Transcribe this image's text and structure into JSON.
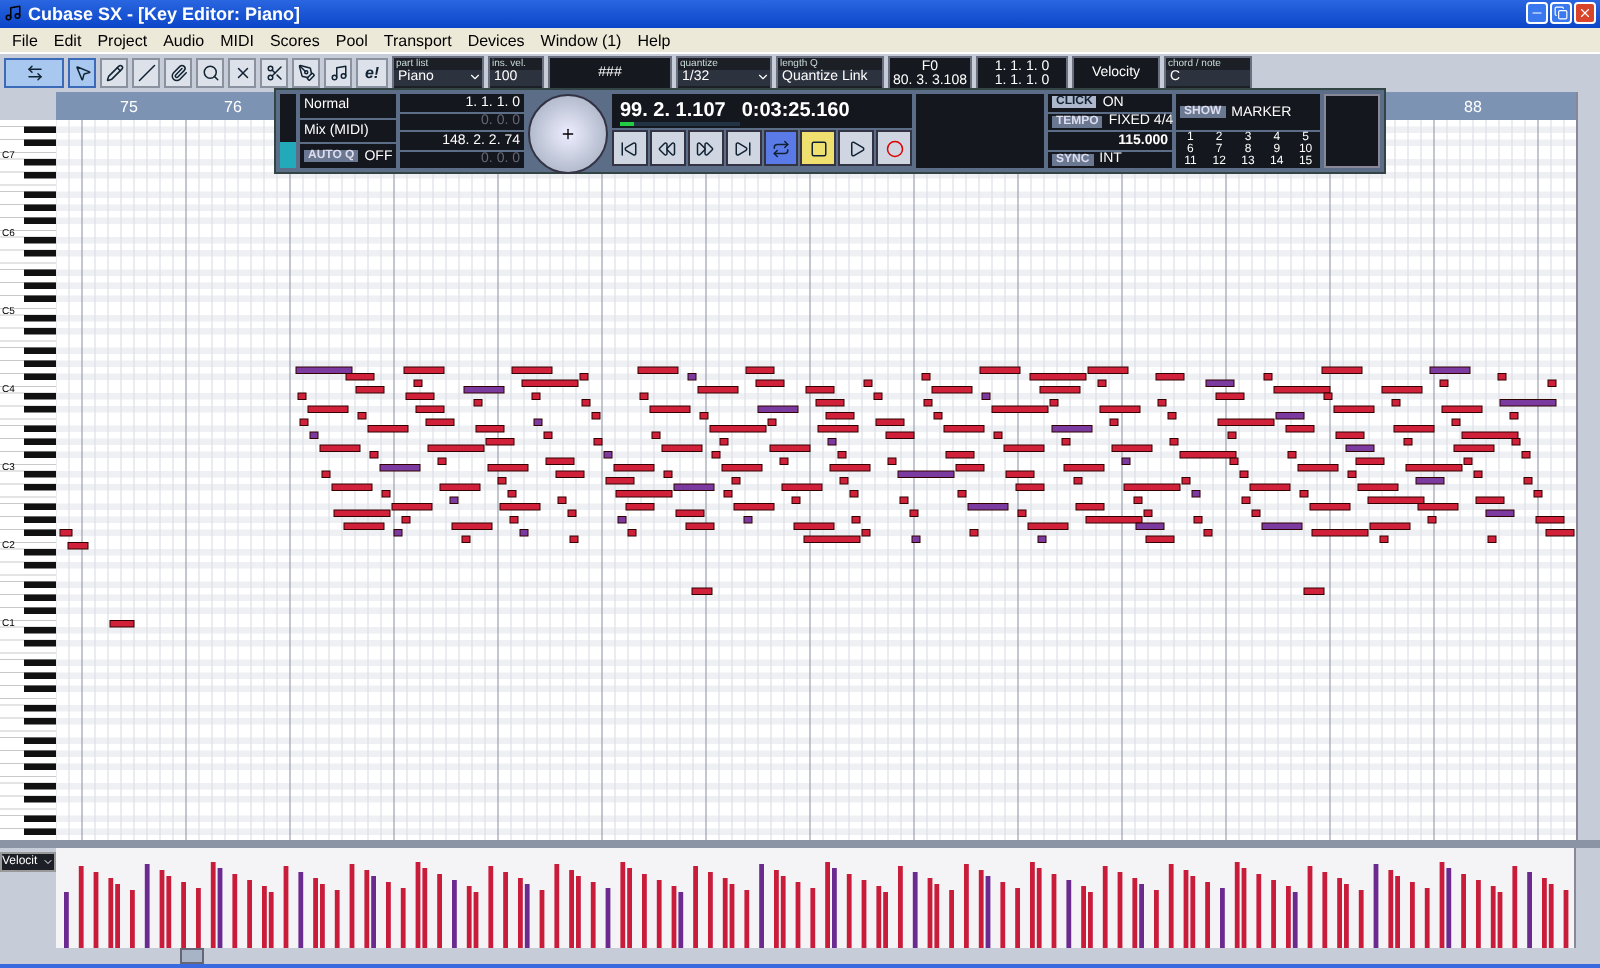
{
  "window": {
    "title": "Cubase SX - [Key Editor: Piano]"
  },
  "menu": [
    "File",
    "Edit",
    "Project",
    "Audio",
    "MIDI",
    "Scores",
    "Pool",
    "Transport",
    "Devices",
    "Window (1)",
    "Help"
  ],
  "toolbar": {
    "tools": [
      {
        "kind": "arrow",
        "selected": true
      },
      {
        "kind": "pencil",
        "selected": false
      },
      {
        "kind": "line",
        "selected": false
      },
      {
        "kind": "glue",
        "selected": false
      },
      {
        "kind": "zoom",
        "selected": false
      },
      {
        "kind": "mute",
        "selected": false
      },
      {
        "kind": "split",
        "selected": false
      },
      {
        "kind": "pen",
        "selected": false
      },
      {
        "kind": "drum",
        "selected": false
      }
    ],
    "autoscroll": {
      "on": true
    },
    "edit_in_place": "e!",
    "part_list": {
      "label": "part list",
      "value": "Piano"
    },
    "ins_vel": {
      "label": "ins. vel.",
      "value": "100"
    },
    "grid_value": "###",
    "quantize": {
      "label": "quantize",
      "value": "1/32"
    },
    "length_q": {
      "label": "length Q",
      "value": "Quantize Link"
    },
    "mouse_note": "F0",
    "mouse_position": "80. 3. 3.108",
    "note_start": "1. 1. 1. 0",
    "note_end": "1. 1. 1. 0",
    "colors": {
      "value": "Velocity"
    },
    "chord": {
      "label": "chord / note",
      "value": "C"
    }
  },
  "ruler": [
    "75",
    "76",
    "88"
  ],
  "transport": {
    "modes": [
      "Normal",
      "Mix (MIDI)"
    ],
    "autoq": {
      "label": "AUTO Q",
      "value": "OFF"
    },
    "left_locator": "1. 1. 1. 0",
    "left_offset": "0. 0. 0",
    "right_locator": "148. 2. 2. 74",
    "right_offset": "0. 0. 0",
    "primary_position": "99. 2. 1.107",
    "secondary_position": "0:03:25.160",
    "level": 0.12,
    "buttons": [
      {
        "kind": "start",
        "active": false
      },
      {
        "kind": "rewind",
        "active": false
      },
      {
        "kind": "forward",
        "active": false
      },
      {
        "kind": "end",
        "active": false
      },
      {
        "kind": "cycle",
        "active": true
      },
      {
        "kind": "stop",
        "active": true
      },
      {
        "kind": "play",
        "active": false
      },
      {
        "kind": "record",
        "active": false
      }
    ],
    "click": {
      "label": "CLICK",
      "value": "ON"
    },
    "tempo": {
      "label": "TEMPO",
      "mode": "FIXED",
      "signature": "4/4",
      "value": "115.000"
    },
    "sync": {
      "label": "SYNC",
      "value": "INT"
    },
    "markers": {
      "show": "SHOW",
      "label": "MARKER",
      "numbers": [
        "1",
        "2",
        "3",
        "4",
        "5",
        "6",
        "7",
        "8",
        "9",
        "10",
        "11",
        "12",
        "13",
        "14",
        "15"
      ]
    }
  },
  "keyboard": [
    "C7",
    "C6",
    "C5",
    "C4",
    "C3",
    "C2",
    "C1"
  ],
  "controller": {
    "parameter": "Velocit"
  }
}
